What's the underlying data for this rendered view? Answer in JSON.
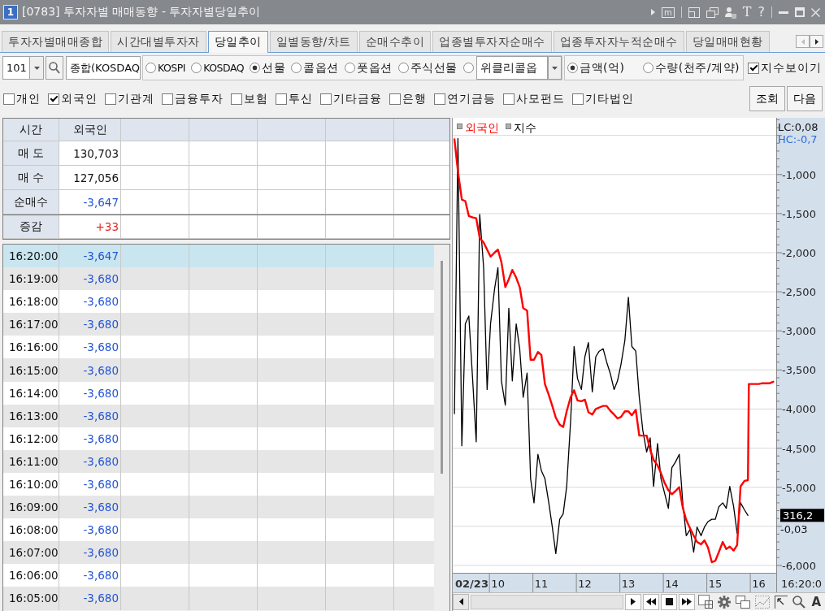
{
  "window": {
    "badge": "1",
    "title": "[0783] 투자자별 매매동향 - 투자자별당일추이",
    "memo_button": "m",
    "font_button": "T",
    "help_button": "?"
  },
  "tabs": [
    {
      "label": "투자자별매매종합",
      "selected": false
    },
    {
      "label": "시간대별투자자",
      "selected": false
    },
    {
      "label": "당일추이",
      "selected": true
    },
    {
      "label": "일별동향/차트",
      "selected": false
    },
    {
      "label": "순매수추이",
      "selected": false
    },
    {
      "label": "업종별투자자순매수",
      "selected": false
    },
    {
      "label": "업종투자자누적순매수",
      "selected": false
    },
    {
      "label": "당일매매현황",
      "selected": false
    }
  ],
  "toolbar": {
    "code": "101",
    "market_field": "종합(KOSDAQ",
    "markets": [
      {
        "label": "KOSPI",
        "selected": false
      },
      {
        "label": "KOSDAQ",
        "selected": false
      },
      {
        "label": "선물",
        "selected": true
      },
      {
        "label": "콜옵션",
        "selected": false
      },
      {
        "label": "풋옵션",
        "selected": false
      },
      {
        "label": "주식선물",
        "selected": false
      }
    ],
    "weekly": {
      "selected": false,
      "value": "위클리콜옵"
    },
    "units": [
      {
        "label": "금액(억)",
        "selected": true
      },
      {
        "label": "수량(천주/계약)",
        "selected": false
      }
    ],
    "show_index": {
      "label": "지수보이기",
      "checked": true
    }
  },
  "investors": [
    {
      "label": "개인",
      "checked": false
    },
    {
      "label": "외국인",
      "checked": true
    },
    {
      "label": "기관계",
      "checked": false
    },
    {
      "label": "금융투자",
      "checked": false
    },
    {
      "label": "보험",
      "checked": false
    },
    {
      "label": "투신",
      "checked": false
    },
    {
      "label": "기타금융",
      "checked": false
    },
    {
      "label": "은행",
      "checked": false
    },
    {
      "label": "연기금등",
      "checked": false
    },
    {
      "label": "사모펀드",
      "checked": false
    },
    {
      "label": "기타법인",
      "checked": false
    }
  ],
  "buttons": [
    "조회",
    "다음"
  ],
  "summary": {
    "header": [
      "시간",
      "외국인"
    ],
    "rows": [
      {
        "label": "매 도",
        "value": "130,703",
        "color": "#111111"
      },
      {
        "label": "매 수",
        "value": "127,056",
        "color": "#111111"
      },
      {
        "label": "순매수",
        "value": "-3,647",
        "color": "#2255d6"
      },
      {
        "label": "증감",
        "value": "+33",
        "color": "#e8231b"
      }
    ]
  },
  "time_rows": [
    {
      "time": "16:20:00",
      "value": "-3,647",
      "color": "#2255d6",
      "selected": true
    },
    {
      "time": "16:19:00",
      "value": "-3,680",
      "color": "#2255d6",
      "selected": false
    },
    {
      "time": "16:18:00",
      "value": "-3,680",
      "color": "#2255d6",
      "selected": false
    },
    {
      "time": "16:17:00",
      "value": "-3,680",
      "color": "#2255d6",
      "selected": false
    },
    {
      "time": "16:16:00",
      "value": "-3,680",
      "color": "#2255d6",
      "selected": false
    },
    {
      "time": "16:15:00",
      "value": "-3,680",
      "color": "#2255d6",
      "selected": false
    },
    {
      "time": "16:14:00",
      "value": "-3,680",
      "color": "#2255d6",
      "selected": false
    },
    {
      "time": "16:13:00",
      "value": "-3,680",
      "color": "#2255d6",
      "selected": false
    },
    {
      "time": "16:12:00",
      "value": "-3,680",
      "color": "#2255d6",
      "selected": false
    },
    {
      "time": "16:11:00",
      "value": "-3,680",
      "color": "#2255d6",
      "selected": false
    },
    {
      "time": "16:10:00",
      "value": "-3,680",
      "color": "#2255d6",
      "selected": false
    },
    {
      "time": "16:09:00",
      "value": "-3,680",
      "color": "#2255d6",
      "selected": false
    },
    {
      "time": "16:08:00",
      "value": "-3,680",
      "color": "#2255d6",
      "selected": false
    },
    {
      "time": "16:07:00",
      "value": "-3,680",
      "color": "#2255d6",
      "selected": false
    },
    {
      "time": "16:06:00",
      "value": "-3,680",
      "color": "#2255d6",
      "selected": false
    },
    {
      "time": "16:05:00",
      "value": "-3,680",
      "color": "#2255d6",
      "selected": false
    }
  ],
  "chart": {
    "chart_data": {
      "type": "line",
      "x": [
        9,
        9.08,
        9.17,
        9.25,
        9.33,
        9.42,
        9.5,
        9.58,
        9.67,
        9.75,
        9.83,
        9.92,
        10,
        10.08,
        10.17,
        10.25,
        10.33,
        10.42,
        10.5,
        10.58,
        10.67,
        10.75,
        10.83,
        10.92,
        11,
        11.08,
        11.17,
        11.25,
        11.33,
        11.42,
        11.5,
        11.58,
        11.67,
        11.75,
        11.83,
        11.92,
        12,
        12.08,
        12.17,
        12.25,
        12.33,
        12.42,
        12.5,
        12.58,
        12.67,
        12.75,
        12.83,
        12.92,
        13,
        13.08,
        13.17,
        13.25,
        13.33,
        13.42,
        13.5,
        13.58,
        13.67,
        13.75,
        13.83,
        13.92,
        14,
        14.08,
        14.17,
        14.25,
        14.33,
        14.42,
        14.5,
        14.58,
        14.67,
        14.75,
        14.83,
        14.92,
        15,
        15.08,
        15.17,
        15.25,
        15.33,
        15.42,
        15.5,
        15.58,
        15.67,
        15.75,
        15.77,
        15.83,
        15.92,
        16,
        16.08,
        16.17,
        16.25,
        16.33
      ],
      "series": [
        {
          "name": "외국인",
          "color": "#ff0000",
          "values": [
            -550,
            -960,
            -1320,
            -1340,
            -1530,
            -1550,
            -1560,
            -1810,
            -1870,
            -1960,
            -2050,
            -2000,
            -1960,
            -2120,
            -2440,
            -2340,
            -2220,
            -2320,
            -2440,
            -2710,
            -2740,
            -3370,
            -3370,
            -3270,
            -3310,
            -3680,
            -3820,
            -3960,
            -4110,
            -4200,
            -4230,
            -4030,
            -3850,
            -3760,
            -3890,
            -3900,
            -3880,
            -4040,
            -4070,
            -4000,
            -3980,
            -3960,
            -3960,
            -4020,
            -4070,
            -4120,
            -4100,
            -4030,
            -4030,
            -4080,
            -4010,
            -4340,
            -4340,
            -4340,
            -4520,
            -4650,
            -4720,
            -4820,
            -4940,
            -5040,
            -5090,
            -5050,
            -5000,
            -5260,
            -5420,
            -5530,
            -5620,
            -5700,
            -5730,
            -5680,
            -5770,
            -5960,
            -5940,
            -5830,
            -5700,
            -5790,
            -5760,
            -5810,
            -5740,
            -4990,
            -4920,
            -4910,
            -3680,
            -3680,
            -3680,
            -3680,
            -3670,
            -3670,
            -3670,
            -3650
          ]
        },
        {
          "name": "지수",
          "color": "#000000",
          "values": [
            -4060,
            -540,
            -4470,
            -2910,
            -2810,
            -3640,
            -4420,
            -1510,
            -2190,
            -3750,
            -2910,
            -2470,
            -2190,
            -3640,
            -3950,
            -2710,
            -3640,
            -2910,
            -3230,
            -3850,
            -3540,
            -4890,
            -5200,
            -4580,
            -4790,
            -4890,
            -5200,
            -5510,
            -5850,
            -5410,
            -5340,
            -4990,
            -4160,
            -3200,
            -3610,
            -3750,
            -3330,
            -3150,
            -3780,
            -3330,
            -3260,
            -3230,
            -3400,
            -3540,
            -3750,
            -3640,
            -3430,
            -3120,
            -2570,
            -3200,
            -3260,
            -3850,
            -4270,
            -4550,
            -4370,
            -4990,
            -4440,
            -4890,
            -5070,
            -5270,
            -4750,
            -4680,
            -4580,
            -5200,
            -5620,
            -5540,
            -5830,
            -5510,
            -5620,
            -5510,
            -5440,
            -5410,
            -5410,
            -5250,
            -5200,
            -5270,
            -4990,
            -5250,
            -5590,
            -5200,
            -5290,
            -5360,
            null,
            null,
            null,
            null,
            null,
            null,
            null,
            null
          ]
        }
      ],
      "xlim": [
        8.96,
        16.4
      ],
      "ylim": [
        -6095,
        -285
      ],
      "xticks": [
        {
          "value": 10,
          "label": "10"
        },
        {
          "value": 11,
          "label": "11"
        },
        {
          "value": 12,
          "label": "12"
        },
        {
          "value": 13,
          "label": "13"
        },
        {
          "value": 14,
          "label": "14"
        },
        {
          "value": 15,
          "label": "15"
        },
        {
          "value": 16,
          "label": "16"
        }
      ],
      "yticks": [
        {
          "value": -1000,
          "label": "-1,000"
        },
        {
          "value": -1500,
          "label": "-1,500"
        },
        {
          "value": -2000,
          "label": "-2,000"
        },
        {
          "value": -2500,
          "label": "-2,500"
        },
        {
          "value": -3000,
          "label": "-3,000"
        },
        {
          "value": -3500,
          "label": "-3,500"
        },
        {
          "value": -4000,
          "label": "-4,000"
        },
        {
          "value": -4500,
          "label": "-4,500"
        },
        {
          "value": -5000,
          "label": "-5,000"
        },
        {
          "value": -6000,
          "label": "-6,000"
        }
      ],
      "grid": true
    },
    "date_label": "02/23",
    "cursor_time": "16:20:0",
    "lc_label": "LC:0,08",
    "hc_label": "HC:-0,7",
    "index_price": "316,2",
    "index_change": "-0,03",
    "text_tool": "A"
  }
}
